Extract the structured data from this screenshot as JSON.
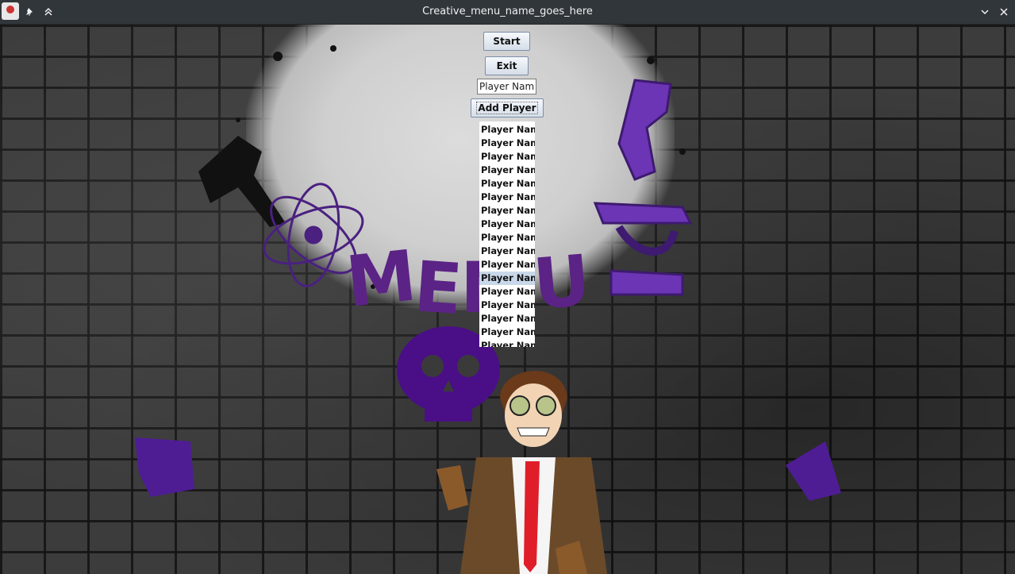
{
  "window": {
    "title": "Creative_menu_name_goes_here"
  },
  "menu": {
    "start_label": "Start",
    "exit_label": "Exit",
    "name_field_value": "Player Name",
    "add_player_label": "Add Player"
  },
  "players": [
    "Player Name",
    "Player Name",
    "Player Name",
    "Player Name",
    "Player Name",
    "Player Name",
    "Player Name",
    "Player Name",
    "Player Name",
    "Player Name",
    "Player Name",
    "Player Name",
    "Player Name",
    "Player Name",
    "Player Name",
    "Player Name",
    "Player Name",
    "Player Name"
  ],
  "selected_player_index": 11,
  "background": {
    "graffiti_text": "MENU",
    "accent_color": "#5a1f8c",
    "brick_color": "#3c3c3c"
  }
}
